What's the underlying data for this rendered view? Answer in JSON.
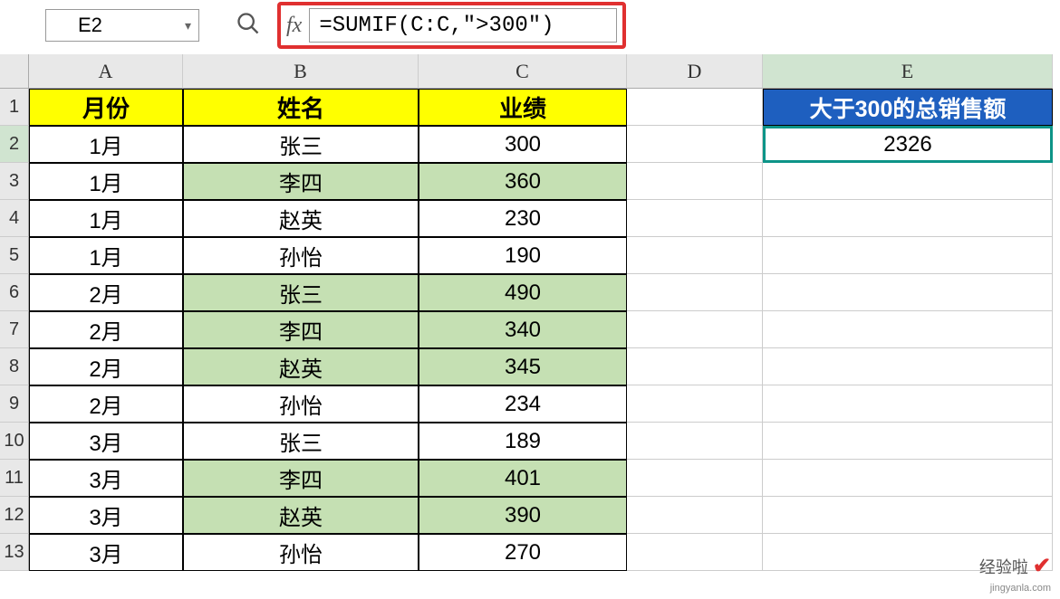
{
  "formula_bar": {
    "cell_reference": "E2",
    "fx_label": "fx",
    "formula": "=SUMIF(C:C,\">300\")"
  },
  "columns": {
    "A": "A",
    "B": "B",
    "C": "C",
    "D": "D",
    "E": "E"
  },
  "row_numbers": [
    "1",
    "2",
    "3",
    "4",
    "5",
    "6",
    "7",
    "8",
    "9",
    "10",
    "11",
    "12",
    "13"
  ],
  "headers": {
    "month": "月份",
    "name": "姓名",
    "performance": "业绩",
    "total_over_300": "大于300的总销售额"
  },
  "result_value": "2326",
  "data": [
    {
      "month": "1月",
      "name": "张三",
      "perf": "300",
      "hl": false
    },
    {
      "month": "1月",
      "name": "李四",
      "perf": "360",
      "hl": true
    },
    {
      "month": "1月",
      "name": "赵英",
      "perf": "230",
      "hl": false
    },
    {
      "month": "1月",
      "name": "孙怡",
      "perf": "190",
      "hl": false
    },
    {
      "month": "2月",
      "name": "张三",
      "perf": "490",
      "hl": true
    },
    {
      "month": "2月",
      "name": "李四",
      "perf": "340",
      "hl": true
    },
    {
      "month": "2月",
      "name": "赵英",
      "perf": "345",
      "hl": true
    },
    {
      "month": "2月",
      "name": "孙怡",
      "perf": "234",
      "hl": false
    },
    {
      "month": "3月",
      "name": "张三",
      "perf": "189",
      "hl": false
    },
    {
      "month": "3月",
      "name": "李四",
      "perf": "401",
      "hl": true
    },
    {
      "month": "3月",
      "name": "赵英",
      "perf": "390",
      "hl": true
    },
    {
      "month": "3月",
      "name": "孙怡",
      "perf": "270",
      "hl": false
    }
  ],
  "watermark": {
    "main": "经验啦",
    "check": "✔",
    "sub": "jingyanla.com"
  },
  "colors": {
    "highlight_red": "#e03030",
    "header_yellow": "#ffff00",
    "header_blue": "#1e5fbf",
    "green_highlight": "#c5e0b3",
    "active_border": "#0d9488"
  }
}
